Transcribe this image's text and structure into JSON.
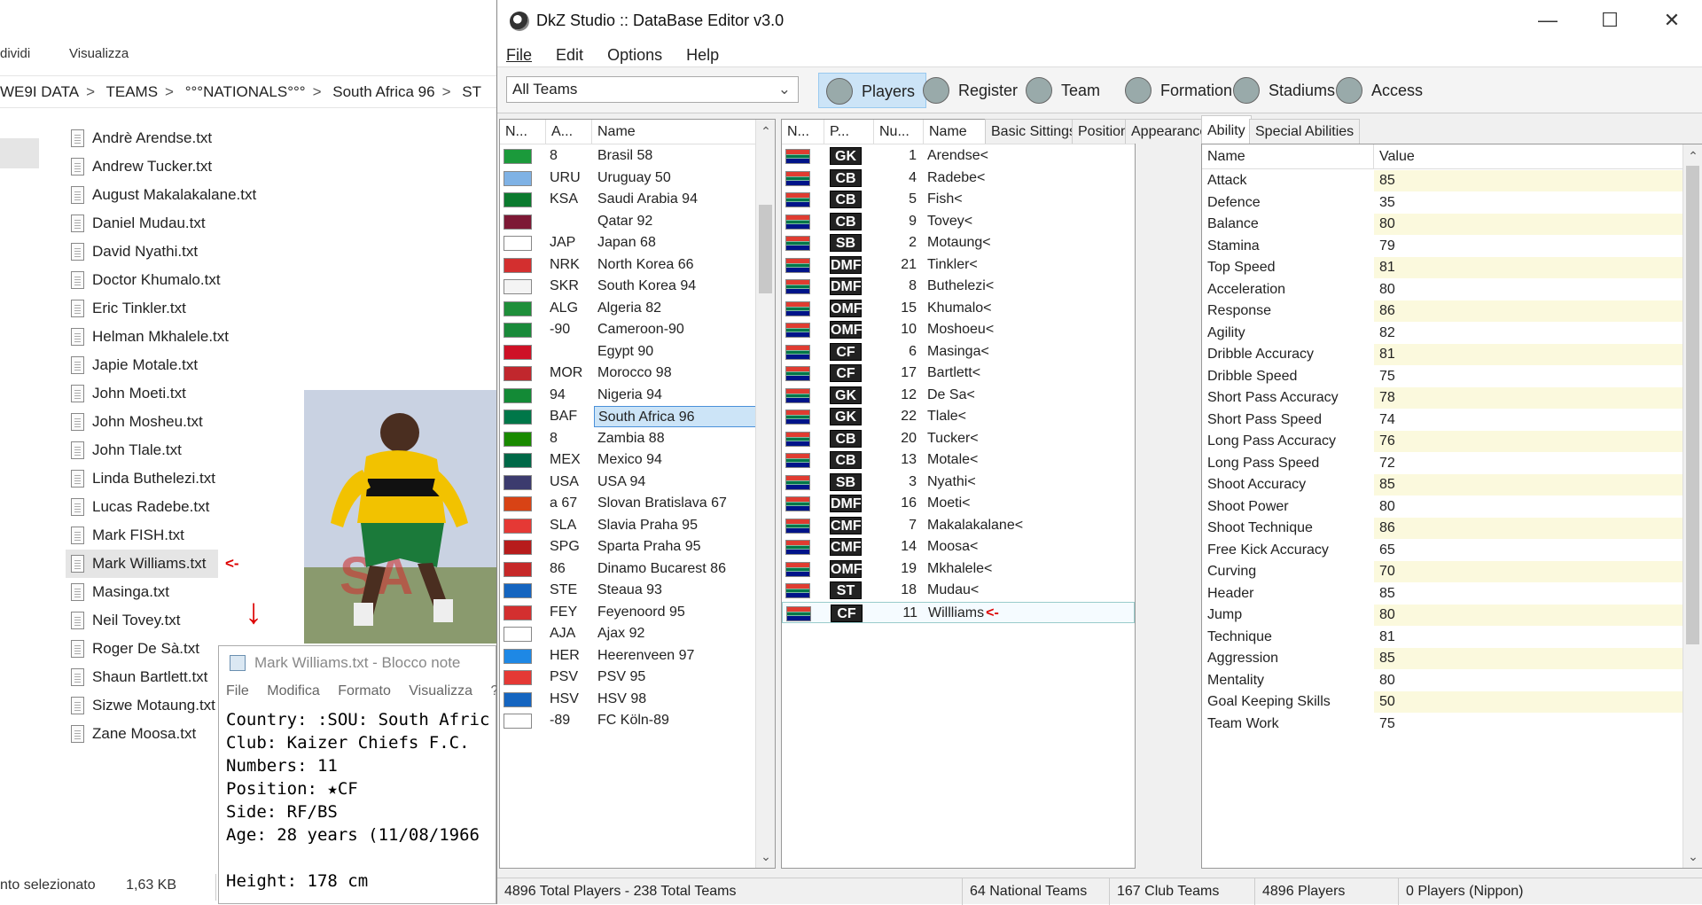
{
  "explorer": {
    "ribbon": [
      "dividi",
      "Visualizza"
    ],
    "breadcrumb": [
      "WE9I DATA",
      "TEAMS",
      "°°°NATIONALS°°°",
      "South Africa 96",
      "ST"
    ],
    "files": [
      "Andrè Arendse.txt",
      "Andrew Tucker.txt",
      "August Makalakalane.txt",
      "Daniel Mudau.txt",
      "David Nyathi.txt",
      "Doctor Khumalo.txt",
      "Eric Tinkler.txt",
      "Helman Mkhalele.txt",
      "Japie Motale.txt",
      "John Moeti.txt",
      "John Mosheu.txt",
      "John Tlale.txt",
      "Linda Buthelezi.txt",
      "Lucas Radebe.txt",
      "Mark FISH.txt",
      "Mark Williams.txt",
      "Masinga.txt",
      "Neil Tovey.txt",
      "Roger De Sà.txt",
      "Shaun Bartlett.txt",
      "Sizwe Motaung.txt",
      "Zane Moosa.txt"
    ],
    "selected_marker": "<-",
    "status_left": "nto selezionato",
    "status_size": "1,63 KB"
  },
  "notepad": {
    "title": "Mark Williams.txt - Blocco note",
    "menu": [
      "File",
      "Modifica",
      "Formato",
      "Visualizza",
      "?"
    ],
    "lines": [
      "Country: :SOU: South Afric",
      "Club: Kaizer Chiefs F.C.",
      "Numbers: 11",
      "Position: ★CF",
      "Side: RF/BS",
      "Age: 28 years (11/08/1966",
      "",
      "Height: 178 cm"
    ]
  },
  "app": {
    "title": "DkZ Studio :: DataBase Editor v3.0",
    "menu": [
      "File",
      "Edit",
      "Options",
      "Help"
    ],
    "team_filter": "All Teams",
    "toolbar": [
      "Players",
      "Register",
      "Team",
      "Formation",
      "Stadiums",
      "Access"
    ]
  },
  "teams_list": {
    "headers": [
      "N...",
      "A...",
      "Name"
    ],
    "rows": [
      {
        "abbr": "8",
        "name": "Brasil 58",
        "flag": "#1b9a3b"
      },
      {
        "abbr": "URU",
        "name": "Uruguay 50",
        "flag": "#7fb2e5"
      },
      {
        "abbr": "KSA",
        "name": "Saudi Arabia 94",
        "flag": "#0b7a2e"
      },
      {
        "abbr": "",
        "name": "Qatar 92",
        "flag": "#7d1835"
      },
      {
        "abbr": "JAP",
        "name": "Japan 68",
        "flag": "#ffffff"
      },
      {
        "abbr": "NRK",
        "name": "North Korea 66",
        "flag": "#d32f2f"
      },
      {
        "abbr": "SKR",
        "name": "South Korea 94",
        "flag": "#f4f4f4"
      },
      {
        "abbr": "ALG",
        "name": "Algeria 82",
        "flag": "#1f8f3a"
      },
      {
        "abbr": "-90",
        "name": "Cameroon-90",
        "flag": "#1a8a3a"
      },
      {
        "abbr": "",
        "name": "Egypt 90",
        "flag": "#ce1126"
      },
      {
        "abbr": "MOR",
        "name": "Morocco 98",
        "flag": "#c1272d"
      },
      {
        "abbr": "94",
        "name": "Nigeria 94",
        "flag": "#138a36"
      },
      {
        "abbr": "BAF",
        "name": "South Africa 96",
        "flag": "#007749"
      },
      {
        "abbr": "8",
        "name": "Zambia 88",
        "flag": "#198a00"
      },
      {
        "abbr": "MEX",
        "name": "Mexico 94",
        "flag": "#006847"
      },
      {
        "abbr": "USA",
        "name": "USA 94",
        "flag": "#3c3b6e"
      },
      {
        "abbr": "a 67",
        "name": "Slovan Bratislava 67",
        "flag": "#d84315"
      },
      {
        "abbr": "SLA",
        "name": "Slavia Praha 95",
        "flag": "#e53935"
      },
      {
        "abbr": "SPG",
        "name": "Sparta Praha 95",
        "flag": "#b71c1c"
      },
      {
        "abbr": "86",
        "name": "Dinamo Bucarest 86",
        "flag": "#c62828"
      },
      {
        "abbr": "STE",
        "name": "Steaua 93",
        "flag": "#1565c0"
      },
      {
        "abbr": "FEY",
        "name": "Feyenoord 95",
        "flag": "#d32f2f"
      },
      {
        "abbr": "AJA",
        "name": "Ajax 92",
        "flag": "#ffffff"
      },
      {
        "abbr": "HER",
        "name": "Heerenveen 97",
        "flag": "#1e88e5"
      },
      {
        "abbr": "PSV",
        "name": "PSV 95",
        "flag": "#e53935"
      },
      {
        "abbr": "HSV",
        "name": "HSV 98",
        "flag": "#1565c0"
      },
      {
        "abbr": "-89",
        "name": "FC Köln-89",
        "flag": "#ffffff"
      }
    ],
    "selected_index": 12
  },
  "players_list": {
    "headers": [
      "N...",
      "P...",
      "Nu...",
      "Name"
    ],
    "rows": [
      {
        "pos": "GK",
        "num": "1",
        "name": "Arendse<"
      },
      {
        "pos": "CB",
        "num": "4",
        "name": "Radebe<"
      },
      {
        "pos": "CB",
        "num": "5",
        "name": "Fish<"
      },
      {
        "pos": "CB",
        "num": "9",
        "name": "Tovey<"
      },
      {
        "pos": "SB",
        "num": "2",
        "name": "Motaung<"
      },
      {
        "pos": "DMF",
        "num": "21",
        "name": "Tinkler<"
      },
      {
        "pos": "DMF",
        "num": "8",
        "name": "Buthelezi<"
      },
      {
        "pos": "OMF",
        "num": "15",
        "name": "Khumalo<"
      },
      {
        "pos": "OMF",
        "num": "10",
        "name": "Moshoeu<"
      },
      {
        "pos": "CF",
        "num": "6",
        "name": "Masinga<"
      },
      {
        "pos": "CF",
        "num": "17",
        "name": "Bartlett<"
      },
      {
        "pos": "GK",
        "num": "12",
        "name": "De Sa<"
      },
      {
        "pos": "GK",
        "num": "22",
        "name": "Tlale<"
      },
      {
        "pos": "CB",
        "num": "20",
        "name": "Tucker<"
      },
      {
        "pos": "CB",
        "num": "13",
        "name": "Motale<"
      },
      {
        "pos": "SB",
        "num": "3",
        "name": "Nyathi<"
      },
      {
        "pos": "DMF",
        "num": "16",
        "name": "Moeti<"
      },
      {
        "pos": "CMF",
        "num": "7",
        "name": "Makalakalane<"
      },
      {
        "pos": "CMF",
        "num": "14",
        "name": "Moosa<"
      },
      {
        "pos": "OMF",
        "num": "19",
        "name": "Mkhalele<"
      },
      {
        "pos": "ST",
        "num": "18",
        "name": "Mudau<"
      },
      {
        "pos": "CF",
        "num": "11",
        "name": "Willliams"
      }
    ],
    "selected_index": 21,
    "selected_marker": "<-"
  },
  "tabs": [
    "Basic Sittings",
    "Position",
    "Appearance",
    "Ability",
    "Special Abilities"
  ],
  "active_tab": 3,
  "ability": {
    "headers": [
      "Name",
      "Value"
    ],
    "rows": [
      {
        "name": "Attack",
        "value": "85"
      },
      {
        "name": "Defence",
        "value": "35"
      },
      {
        "name": "Balance",
        "value": "80"
      },
      {
        "name": "Stamina",
        "value": "79"
      },
      {
        "name": "Top Speed",
        "value": "81"
      },
      {
        "name": "Acceleration",
        "value": "80"
      },
      {
        "name": "Response",
        "value": "86"
      },
      {
        "name": "Agility",
        "value": "82"
      },
      {
        "name": "Dribble Accuracy",
        "value": "81"
      },
      {
        "name": "Dribble Speed",
        "value": "75"
      },
      {
        "name": "Short Pass Accuracy",
        "value": "78"
      },
      {
        "name": "Short Pass Speed",
        "value": "74"
      },
      {
        "name": "Long Pass Accuracy",
        "value": "76"
      },
      {
        "name": "Long Pass Speed",
        "value": "72"
      },
      {
        "name": "Shoot Accuracy",
        "value": "85"
      },
      {
        "name": "Shoot Power",
        "value": "80"
      },
      {
        "name": "Shoot Technique",
        "value": "86"
      },
      {
        "name": "Free Kick Accuracy",
        "value": "65"
      },
      {
        "name": "Curving",
        "value": "70"
      },
      {
        "name": "Header",
        "value": "85"
      },
      {
        "name": "Jump",
        "value": "80"
      },
      {
        "name": "Technique",
        "value": "81"
      },
      {
        "name": "Aggression",
        "value": "85"
      },
      {
        "name": "Mentality",
        "value": "80"
      },
      {
        "name": "Goal Keeping Skills",
        "value": "50"
      },
      {
        "name": "Team Work",
        "value": "75"
      }
    ]
  },
  "statusbar": [
    "4896 Total Players  -  238 Total Teams",
    "64 National Teams",
    "167 Club Teams",
    "4896 Players",
    "0 Players (Nippon)"
  ],
  "colors": {
    "selection": "#cce4f7",
    "highlight": "#fbf9dd",
    "accent_red": "#dd0000"
  }
}
